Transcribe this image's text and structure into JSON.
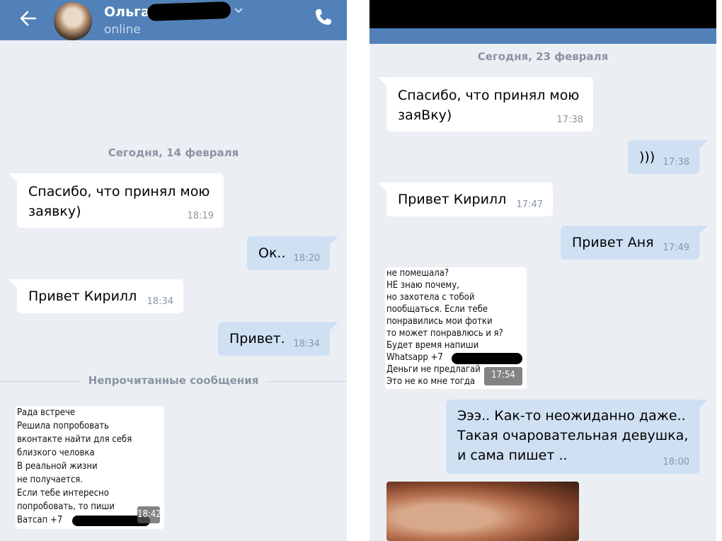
{
  "left": {
    "header": {
      "name": "Ольга",
      "status": "online"
    },
    "date_label": "Сегодня, 14 февраля",
    "messages": [
      {
        "text": "Спасибо, что принял мою\nзаявку)",
        "time": "18:19",
        "dir": "in"
      },
      {
        "text": "Ок..",
        "time": "18:20",
        "dir": "out"
      },
      {
        "text": "Привет Кирилл",
        "time": "18:34",
        "dir": "in"
      },
      {
        "text": "Привет.",
        "time": "18:34",
        "dir": "out"
      }
    ],
    "unread_label": "Непрочитанные сообщения",
    "screenshot_lines": [
      "Рада встрече",
      "Решила попробовать",
      "вконтакте найти для себя",
      "близкого человка",
      "В реальной жизни",
      "не получается.",
      "Если тебе интересно",
      "попробовать, то пиши",
      "Ватсап +7"
    ],
    "screenshot_time": "18:42"
  },
  "right": {
    "date_label": "Сегодня, 23 февраля",
    "messages": [
      {
        "text": "Спасибо, что принял мою\nзаяВку)",
        "time": "17:38",
        "dir": "in"
      },
      {
        "text": ")))",
        "time": "17:38",
        "dir": "out"
      },
      {
        "text": "Привет Кирилл",
        "time": "17:47",
        "dir": "in"
      },
      {
        "text": "Привет Аня",
        "time": "17:49",
        "dir": "out"
      },
      {
        "text": "Эээ.. Как-то неожиданно даже..\nТакая очаровательная девушка,\nи сама пишет ..",
        "time": "18:00",
        "dir": "out"
      }
    ],
    "screenshot_lines": [
      "не помешала?",
      "НЕ знаю почему,",
      "но захотела с тобой",
      "пообщаться. Если тебе",
      "понравились мои фотки",
      "то может понравлюсь и я?",
      "Будет время напиши",
      "Whatsapp +7",
      "Деньги не предлагай",
      "Это не ко мне тогда"
    ],
    "screenshot_time": "17:54"
  },
  "colors": {
    "header": "#5181b8",
    "chat_bg": "#ebeff4",
    "outgoing": "#cfe0f3",
    "incoming": "#ffffff"
  },
  "icons": [
    "back-arrow-icon",
    "chevron-down-icon",
    "phone-icon"
  ]
}
